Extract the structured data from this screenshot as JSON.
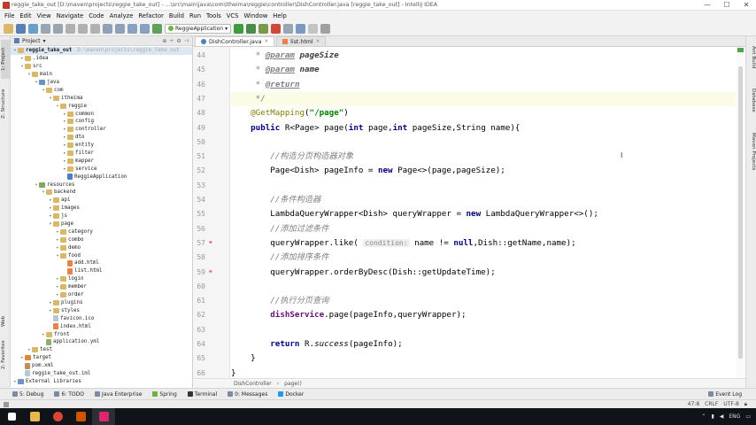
{
  "window": {
    "title": "reggie_take_out [D:\\maven\\projects\\reggie_take_out] - ...\\src\\main\\java\\com\\itheima\\reggie\\controller\\DishController.java [reggie_take_out] - IntelliJ IDEA",
    "controls": [
      "—",
      "☐",
      "✕"
    ]
  },
  "menu": [
    "File",
    "Edit",
    "View",
    "Navigate",
    "Code",
    "Analyze",
    "Refactor",
    "Build",
    "Run",
    "Tools",
    "VCS",
    "Window",
    "Help"
  ],
  "toolbar": {
    "run_config": "ReggieApplication"
  },
  "left_strip": {
    "tabs": [
      "1: Project",
      "Z: Structure",
      "Web",
      "2: Favorites"
    ]
  },
  "right_strip": {
    "tabs": [
      "Ant Build",
      "Database",
      "Maven Projects"
    ]
  },
  "project": {
    "header": "Project",
    "tree": [
      {
        "label": "reggie_take_out",
        "hint": "D:\\maven\\projects\\reggie_take_out",
        "depth": 0,
        "kind": "module",
        "open": true
      },
      {
        "label": ".idea",
        "depth": 1,
        "kind": "folder",
        "open": false
      },
      {
        "label": "src",
        "depth": 1,
        "kind": "folder",
        "open": true
      },
      {
        "label": "main",
        "depth": 2,
        "kind": "folder",
        "open": true
      },
      {
        "label": "java",
        "depth": 3,
        "kind": "src",
        "open": true
      },
      {
        "label": "com",
        "depth": 4,
        "kind": "folder",
        "open": true
      },
      {
        "label": "itheima",
        "depth": 5,
        "kind": "folder",
        "open": true
      },
      {
        "label": "reggie",
        "depth": 6,
        "kind": "folder",
        "open": true
      },
      {
        "label": "common",
        "depth": 7,
        "kind": "folder",
        "open": false
      },
      {
        "label": "config",
        "depth": 7,
        "kind": "folder",
        "open": false
      },
      {
        "label": "controller",
        "depth": 7,
        "kind": "folder",
        "open": false
      },
      {
        "label": "dto",
        "depth": 7,
        "kind": "folder",
        "open": false
      },
      {
        "label": "entity",
        "depth": 7,
        "kind": "folder",
        "open": false
      },
      {
        "label": "filter",
        "depth": 7,
        "kind": "folder",
        "open": false
      },
      {
        "label": "mapper",
        "depth": 7,
        "kind": "folder",
        "open": false
      },
      {
        "label": "service",
        "depth": 7,
        "kind": "folder",
        "open": false
      },
      {
        "label": "ReggieApplication",
        "depth": 7,
        "kind": "java"
      },
      {
        "label": "resources",
        "depth": 3,
        "kind": "res",
        "open": true
      },
      {
        "label": "backend",
        "depth": 4,
        "kind": "folder",
        "open": true
      },
      {
        "label": "api",
        "depth": 5,
        "kind": "folder",
        "open": false
      },
      {
        "label": "images",
        "depth": 5,
        "kind": "folder",
        "open": false
      },
      {
        "label": "js",
        "depth": 5,
        "kind": "folder",
        "open": false
      },
      {
        "label": "page",
        "depth": 5,
        "kind": "folder",
        "open": true
      },
      {
        "label": "category",
        "depth": 6,
        "kind": "folder",
        "open": false
      },
      {
        "label": "combo",
        "depth": 6,
        "kind": "folder",
        "open": false
      },
      {
        "label": "demo",
        "depth": 6,
        "kind": "folder",
        "open": false
      },
      {
        "label": "food",
        "depth": 6,
        "kind": "folder",
        "open": true
      },
      {
        "label": "add.html",
        "depth": 7,
        "kind": "html"
      },
      {
        "label": "list.html",
        "depth": 7,
        "kind": "html"
      },
      {
        "label": "login",
        "depth": 6,
        "kind": "folder",
        "open": false
      },
      {
        "label": "member",
        "depth": 6,
        "kind": "folder",
        "open": false
      },
      {
        "label": "order",
        "depth": 6,
        "kind": "folder",
        "open": false
      },
      {
        "label": "plugins",
        "depth": 5,
        "kind": "folder",
        "open": false
      },
      {
        "label": "styles",
        "depth": 5,
        "kind": "folder",
        "open": false
      },
      {
        "label": "favicon.ico",
        "depth": 5,
        "kind": "file"
      },
      {
        "label": "index.html",
        "depth": 5,
        "kind": "html"
      },
      {
        "label": "front",
        "depth": 4,
        "kind": "folder",
        "open": false
      },
      {
        "label": "application.yml",
        "depth": 4,
        "kind": "yml"
      },
      {
        "label": "test",
        "depth": 2,
        "kind": "folder",
        "open": false
      },
      {
        "label": "target",
        "depth": 1,
        "kind": "target",
        "open": false
      },
      {
        "label": "pom.xml",
        "depth": 1,
        "kind": "xml"
      },
      {
        "label": "reggie_take_out.iml",
        "depth": 1,
        "kind": "file"
      },
      {
        "label": "External Libraries",
        "depth": 0,
        "kind": "lib",
        "open": false
      }
    ]
  },
  "editor": {
    "tabs": [
      {
        "label": "DishController.java",
        "active": true
      },
      {
        "label": "list.html",
        "active": false
      }
    ],
    "lines": [
      {
        "n": "44",
        "html": "     <span class='cm'>* </span><span class='doctag'>@param</span> <span class='docname'>pageSize</span>"
      },
      {
        "n": "45",
        "html": "     <span class='cm'>* </span><span class='doctag'>@param</span> <span class='docname'>name</span>"
      },
      {
        "n": "46",
        "html": "     <span class='cm'>* </span><span class='doctag'>@return</span>"
      },
      {
        "n": "47",
        "html": "     <span class='cm'>*/</span>",
        "current": true
      },
      {
        "n": "48",
        "html": "    <span class='an'>@GetMapping</span>(<span class='str'>\"/page\"</span>)"
      },
      {
        "n": "49",
        "html": "    <span class='kw'>public</span> R&lt;Page&gt; page(<span class='kw'>int</span> page,<span class='kw'>int</span> pageSize,String name){"
      },
      {
        "n": "50",
        "html": ""
      },
      {
        "n": "51",
        "html": "        <span class='cm'>//构造分页构造器对象</span>"
      },
      {
        "n": "52",
        "html": "        Page&lt;Dish&gt; pageInfo = <span class='kw'>new</span> Page&lt;&gt;(page,pageSize);"
      },
      {
        "n": "53",
        "html": ""
      },
      {
        "n": "54",
        "html": "        <span class='cm'>//条件构造器</span>"
      },
      {
        "n": "55",
        "html": "        LambdaQueryWrapper&lt;Dish&gt; queryWrapper = <span class='kw'>new</span> LambdaQueryWrapper&lt;&gt;();"
      },
      {
        "n": "56",
        "html": "        <span class='cm'>//添加过滤条件</span>"
      },
      {
        "n": "57",
        "html": "        queryWrapper.like( <span class='hint'>condition:</span> name != <span class='kw'>null</span>,Dish::getName,name);",
        "mark": true
      },
      {
        "n": "58",
        "html": "        <span class='cm'>//添加排序条件</span>"
      },
      {
        "n": "59",
        "html": "        queryWrapper.orderByDesc(Dish::getUpdateTime);",
        "mark": true
      },
      {
        "n": "60",
        "html": ""
      },
      {
        "n": "61",
        "html": "        <span class='cm'>//执行分页查询</span>"
      },
      {
        "n": "62",
        "html": "        <span class='fld'>dishService</span>.page(pageInfo,queryWrapper);"
      },
      {
        "n": "63",
        "html": ""
      },
      {
        "n": "64",
        "html": "        <span class='kw'>return</span> R.<span class='st'>success</span>(pageInfo);"
      },
      {
        "n": "65",
        "html": "    }"
      },
      {
        "n": "66",
        "html": "}"
      }
    ],
    "breadcrumb": [
      "DishController",
      "page()"
    ]
  },
  "bottom_tools": {
    "items": [
      "5: Debug",
      "6: TODO",
      "Java Enterprise",
      "Spring",
      "Terminal",
      "0: Messages",
      "Docker"
    ],
    "right": "Event Log"
  },
  "status": {
    "position": "47:8",
    "line_sep": "CRLF",
    "encoding": "UTF-8"
  },
  "taskbar": {
    "lang": "ENG"
  },
  "colors": {
    "keyword": "#000080",
    "annotation": "#808000",
    "string": "#008000",
    "comment": "#808080",
    "field": "#660e7a"
  }
}
